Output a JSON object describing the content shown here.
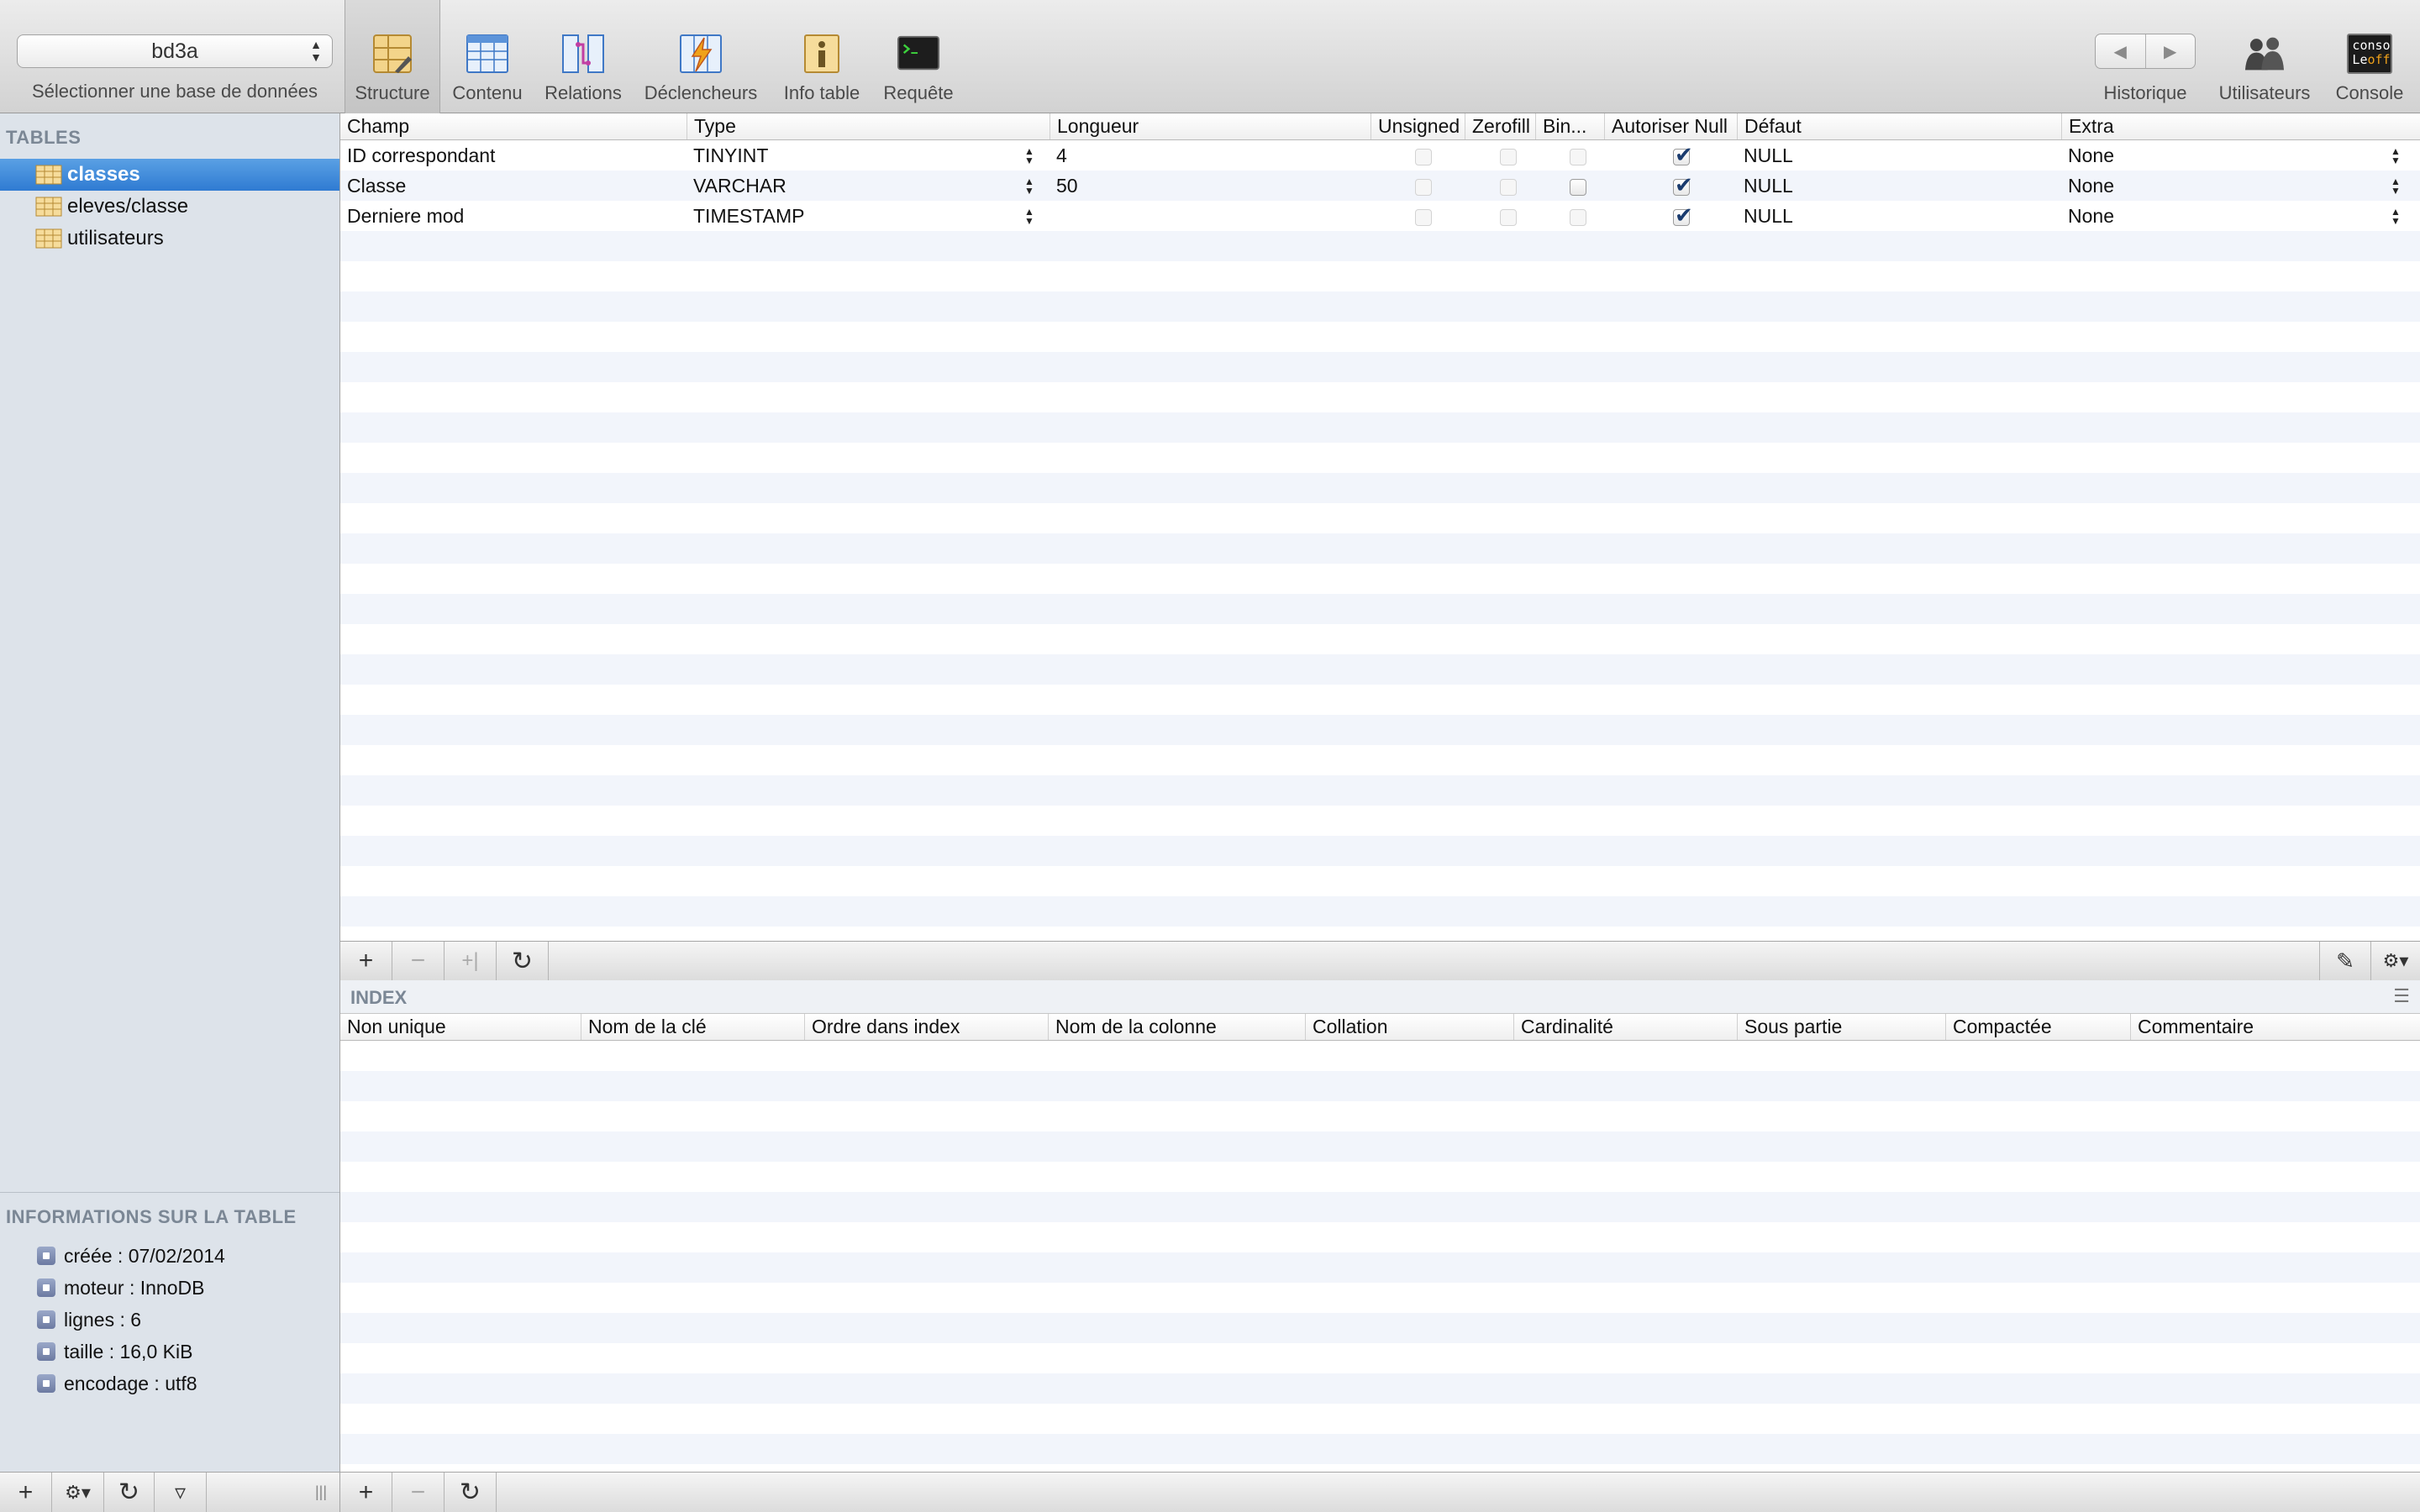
{
  "toolbar": {
    "database": "bd3a",
    "database_label": "Sélectionner une base de données",
    "buttons": {
      "structure": "Structure",
      "content": "Contenu",
      "relations": "Relations",
      "triggers": "Déclencheurs",
      "table_info": "Info table",
      "query": "Requête",
      "history": "Historique",
      "users": "Utilisateurs",
      "console": "Console"
    },
    "console_icon_text_top": "conso",
    "console_icon_text_left": "Le",
    "console_icon_text_right": "off",
    "nav_back": "◀",
    "nav_forward": "▶"
  },
  "sidebar": {
    "tables_header": "TABLES",
    "tables": [
      "classes",
      "eleves/classe",
      "utilisateurs"
    ],
    "selected_table": "classes",
    "info_header": "INFORMATIONS SUR LA TABLE",
    "info": [
      "créée : 07/02/2014",
      "moteur : InnoDB",
      "lignes : 6",
      "taille : 16,0 KiB",
      "encodage : utf8"
    ]
  },
  "structure": {
    "columns": [
      "Champ",
      "Type",
      "Longueur",
      "Unsigned",
      "Zerofill",
      "Bin...",
      "Autoriser Null",
      "Défaut",
      "Extra"
    ],
    "rows": [
      {
        "field": "ID correspondant",
        "type": "TINYINT",
        "length": "4",
        "unsigned": false,
        "zerofill": false,
        "binary": false,
        "allow_null": true,
        "default": "NULL",
        "extra": "None"
      },
      {
        "field": "Classe",
        "type": "VARCHAR",
        "length": "50",
        "unsigned": false,
        "zerofill": false,
        "binary": false,
        "allow_null": true,
        "default": "NULL",
        "extra": "None"
      },
      {
        "field": "Derniere mod",
        "type": "TIMESTAMP",
        "length": "",
        "unsigned": false,
        "zerofill": false,
        "binary": false,
        "allow_null": true,
        "default": "NULL",
        "extra": "None"
      }
    ]
  },
  "index": {
    "title": "INDEX",
    "columns": [
      "Non unique",
      "Nom de la clé",
      "Ordre dans index",
      "Nom de la colonne",
      "Collation",
      "Cardinalité",
      "Sous partie",
      "Compactée",
      "Commentaire"
    ]
  },
  "bottom": {
    "add": "+",
    "remove": "−",
    "duplicate": "+|",
    "refresh": "↻",
    "edit": "✎",
    "gear": "⚙▾",
    "sidebar_gear": "⚙▾",
    "filter": "▿",
    "resize": "|||"
  },
  "colors": {
    "selection": "#3d87d8",
    "sidebar_bg": "#dde3ea",
    "stripe": "#f2f5fb",
    "check": "#1a3b6e"
  }
}
